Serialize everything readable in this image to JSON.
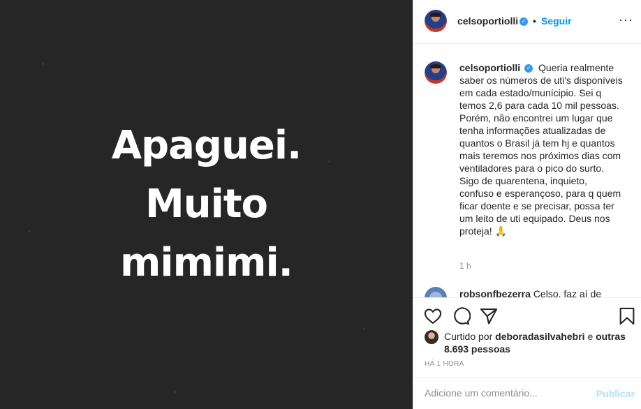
{
  "post": {
    "image_text_lines": [
      "Apaguei.",
      "Muito",
      "mimimi."
    ]
  },
  "header": {
    "username": "celsoportiolli",
    "separator": "•",
    "follow_label": "Seguir",
    "more_label": "···"
  },
  "caption": {
    "username": "celsoportiolli",
    "text": "Queria realmente saber os números de uti's disponíveis em cada estado/munícipio. Sei q temos 2,6 para cada 10 mil pessoas. Porém, não encontrei um lugar que tenha informações atualizadas de quantos o Brasil já tem hj e quantos mais teremos nos próximos dias com ventiladores para o pico do surto. Sigo de quarentena, inquieto, confuso e esperançoso, para q quem ficar doente e se precisar, possa ter um leito de uti equipado. Deus nos proteja! 🙏",
    "time_ago": "1 h"
  },
  "next_comment": {
    "username": "robsonfbezerra",
    "text": "Celso, faz aí de"
  },
  "likes": {
    "prefix": "Curtido por",
    "liker": "deboradasilvahebri",
    "middle": "e",
    "others": "outras 8.693 pessoas"
  },
  "date_label": "HÁ 1 HORA",
  "comment_box": {
    "placeholder": "Adicione um comentário...",
    "publish_label": "Publicar"
  },
  "icons": {
    "verified": "verified-badge-icon",
    "like": "heart-icon",
    "comment": "comment-bubble-icon",
    "share": "paper-plane-icon",
    "save": "bookmark-icon"
  },
  "colors": {
    "accent": "#0095f6",
    "verified": "#3897f0",
    "media_bg": "#262626",
    "publish_disabled": "#b2dffc"
  }
}
